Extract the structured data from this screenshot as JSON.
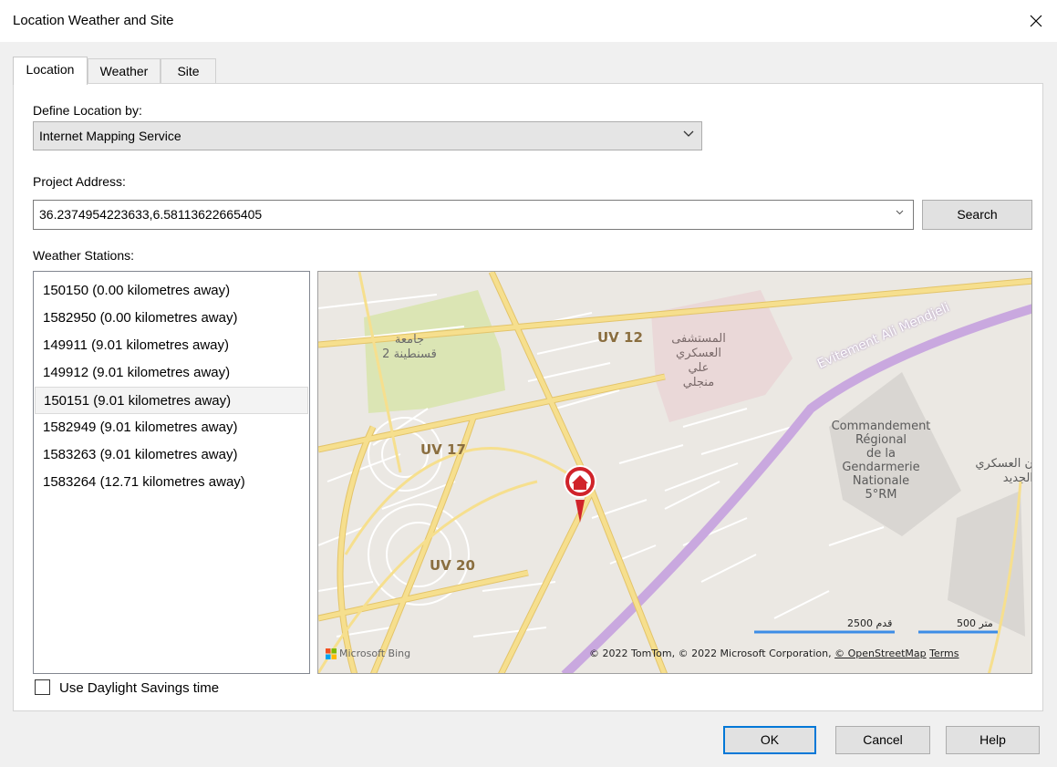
{
  "window": {
    "title": "Location Weather and Site",
    "close_icon": "close-icon"
  },
  "tabs": [
    {
      "label": "Location",
      "active": true
    },
    {
      "label": "Weather",
      "active": false
    },
    {
      "label": "Site",
      "active": false
    }
  ],
  "location": {
    "define_label": "Define Location by:",
    "define_value": "Internet Mapping Service",
    "address_label": "Project Address:",
    "address_value": "36.2374954223633,6.58113622665405",
    "search_label": "Search",
    "stations_label": "Weather Stations:",
    "stations": [
      "150150 (0.00 kilometres away)",
      "1582950 (0.00 kilometres away)",
      "149911 (9.01 kilometres away)",
      "149912 (9.01 kilometres away)",
      "150151 (9.01 kilometres away)",
      "1582949 (9.01 kilometres away)",
      "1583263 (9.01 kilometres away)",
      "1583264 (12.71 kilometres away)"
    ],
    "selected_station_index": 4,
    "daylight_label": "Use Daylight Savings time",
    "daylight_checked": false
  },
  "map": {
    "labels": {
      "uv12": "UV 12",
      "uv17": "UV 17",
      "uv20": "UV 20",
      "univ_line1": "جامعة",
      "univ_line2": "قسنطينة 2",
      "hospital_line1": "المستشفى",
      "hospital_line2": "العسكري",
      "hospital_line3": "علي",
      "hospital_line4": "منجلي",
      "road": "Evitement Ali Mendjeli",
      "gend_line1": "Commandement",
      "gend_line2": "Régional",
      "gend_line3": "de la",
      "gend_line4": "Gendarmerie",
      "gend_line5": "Nationale",
      "gend_line6": "5°RM",
      "right_line1": "ن العسكري",
      "right_line2": "الجديد"
    },
    "scale_feet": "قدم 2500",
    "scale_meters": "متر 500",
    "brand": "Microsoft Bing",
    "copyright": "© 2022 TomTom, © 2022 Microsoft Corporation,",
    "osm": "© OpenStreetMap",
    "terms": "Terms",
    "colors": {
      "road": "#f6df8e",
      "road_edge": "#e3c46a",
      "highway": "#c9a8df",
      "green": "#dbe5b4",
      "pink": "#ead8d8",
      "marker": "#d0232a"
    }
  },
  "buttons": {
    "ok": "OK",
    "cancel": "Cancel",
    "help": "Help"
  }
}
